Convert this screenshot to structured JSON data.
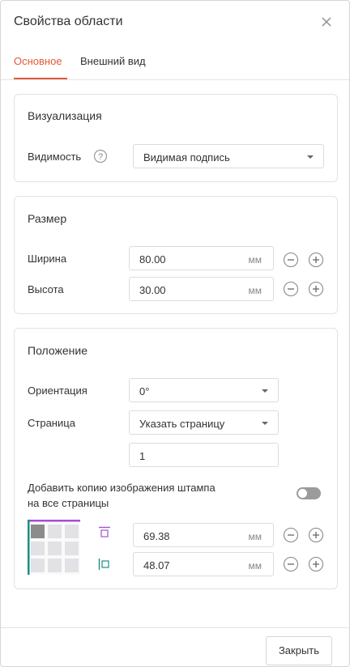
{
  "dialog": {
    "title": "Свойства области",
    "close_label": "Закрыть"
  },
  "tabs": [
    {
      "label": "Основное",
      "active": true
    },
    {
      "label": "Внешний вид",
      "active": false
    }
  ],
  "visualization": {
    "heading": "Визуализация",
    "visibility_label": "Видимость",
    "visibility_value": "Видимая подпись"
  },
  "size": {
    "heading": "Размер",
    "width_label": "Ширина",
    "width_value": "80.00",
    "height_label": "Высота",
    "height_value": "30.00",
    "unit": "мм"
  },
  "position": {
    "heading": "Положение",
    "orientation_label": "Ориентация",
    "orientation_value": "0°",
    "page_label": "Страница",
    "page_value": "Указать страницу",
    "page_number": "1",
    "copy_label_line1": "Добавить копию изображения штампа",
    "copy_label_line2": "на все страницы",
    "copy_enabled": false,
    "top_value": "69.38",
    "left_value": "48.07",
    "unit": "мм"
  },
  "colors": {
    "accent": "#e05a3a",
    "anchor_purple": "#a24fd6",
    "anchor_teal": "#1a8f88"
  }
}
